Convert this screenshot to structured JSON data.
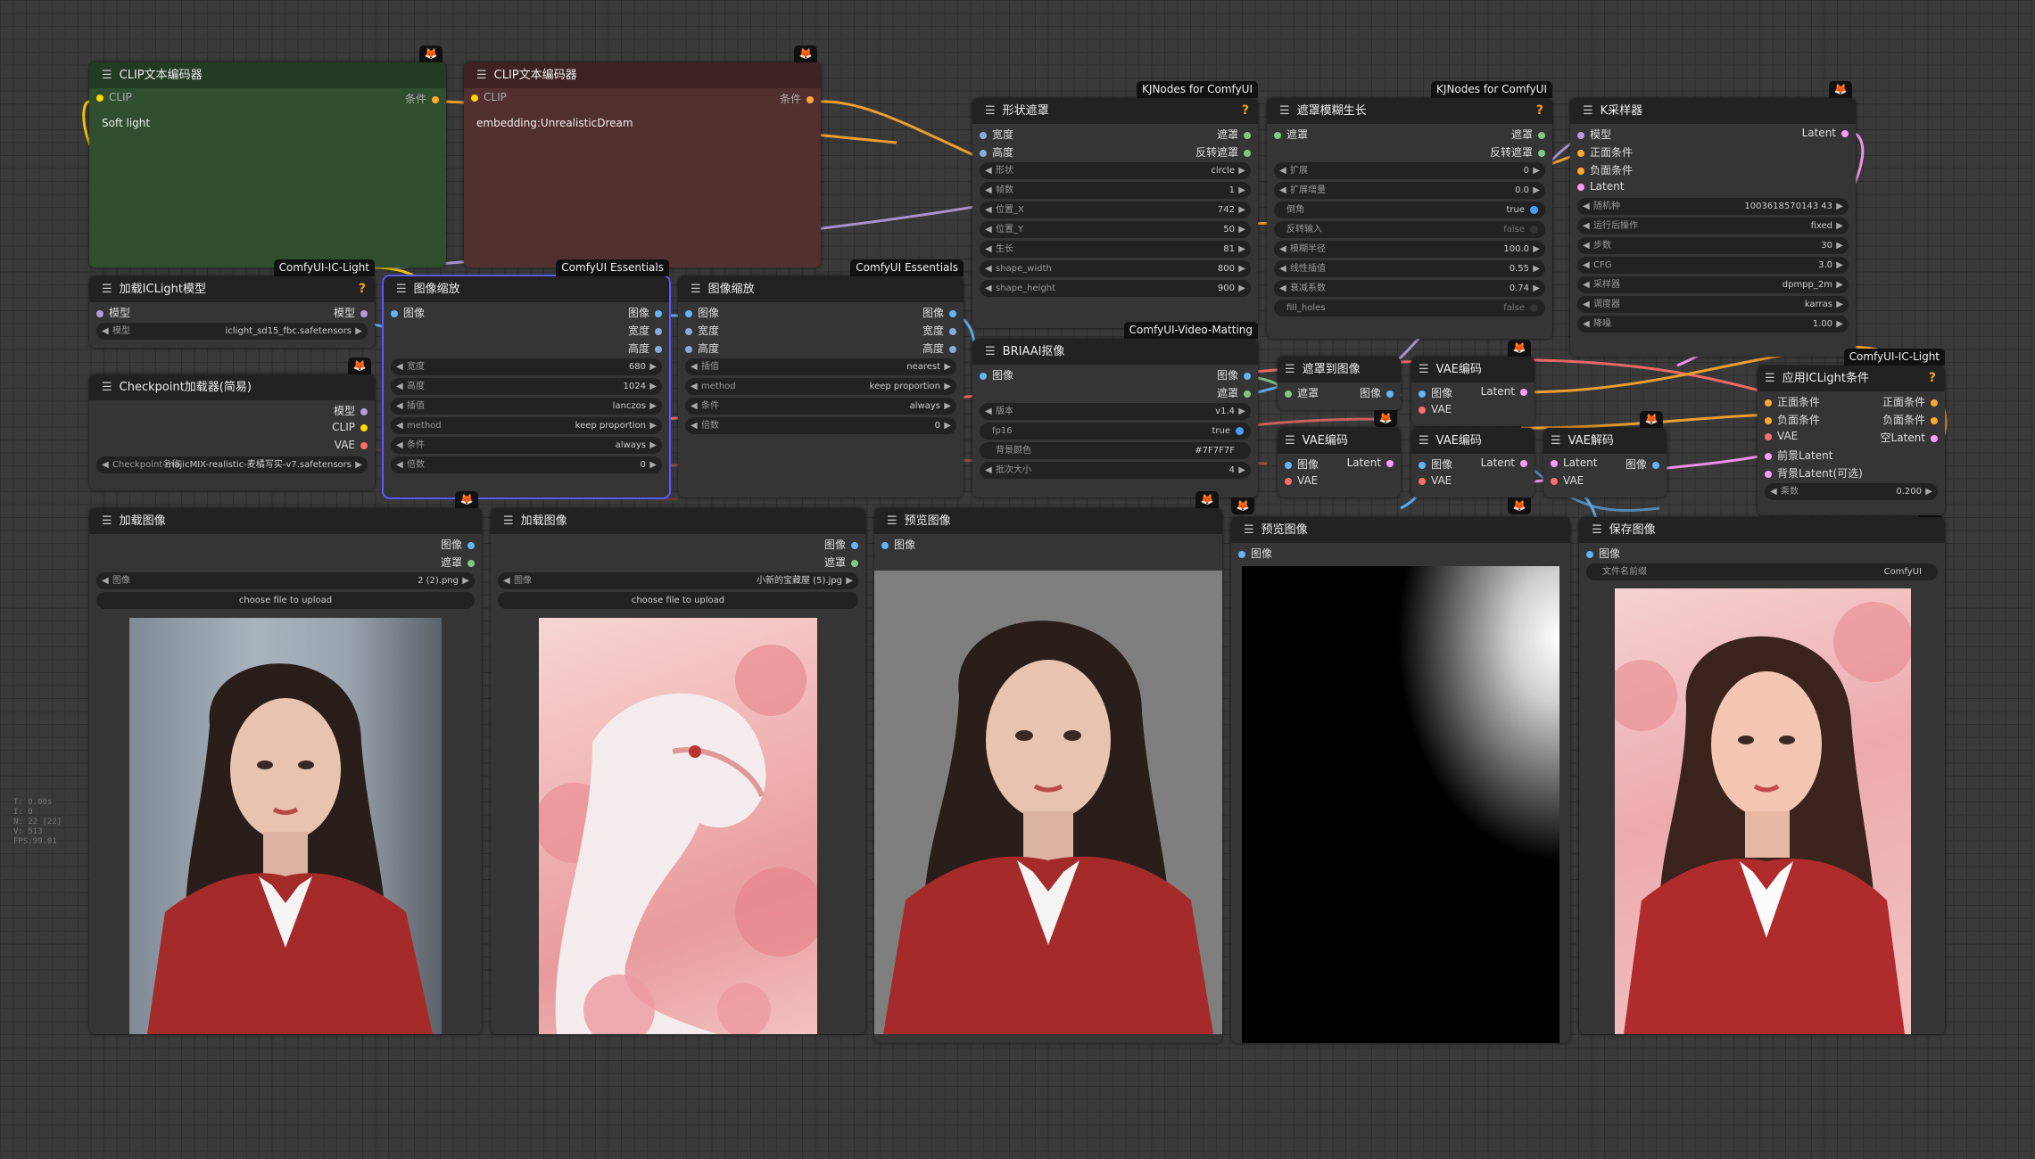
{
  "colors": {
    "clip_text_green_bg": "#2f4f2f",
    "clip_text_red_bg": "#533030",
    "image_wire": "#64b5f6",
    "mask_wire": "#81c784",
    "clip_wire": "#ffd500",
    "conditioning_wire": "#ffa931",
    "model_wire": "#b39ddb",
    "vae_wire": "#ff6e6e",
    "latent_wire": "#ff9cf9"
  },
  "nodes": {
    "clip_pos": {
      "title": "CLIP文本编码器",
      "in": "CLIP",
      "out": "条件",
      "text": "Soft light"
    },
    "clip_neg": {
      "title": "CLIP文本编码器",
      "in": "CLIP",
      "out": "条件",
      "text": "embedding:UnrealisticDream"
    },
    "iclight_loader": {
      "title": "加载ICLight模型",
      "badge": "ComfyUI-IC-Light",
      "in": "模型",
      "out": "模型",
      "w_name": "模型",
      "w_val": "iclight_sd15_fbc.safetensors"
    },
    "ckpt": {
      "title": "Checkpoint加载器(简易)",
      "out1": "模型",
      "out2": "CLIP",
      "out3": "VAE",
      "w_name": "Checkpoint名称",
      "w_val": "majicMIX-realistic-麦橘写实-v7.safetensors"
    },
    "scale1": {
      "title": "图像缩放",
      "badge": "ComfyUI Essentials",
      "in1": "图像",
      "out1": "图像",
      "out2": "宽度",
      "out3": "高度",
      "widgets": [
        [
          "宽度",
          "680"
        ],
        [
          "高度",
          "1024"
        ],
        [
          "插值",
          "lanczos"
        ],
        [
          "method",
          "keep proportion"
        ],
        [
          "条件",
          "always"
        ],
        [
          "倍数",
          "0"
        ]
      ]
    },
    "scale2": {
      "title": "图像缩放",
      "badge": "ComfyUI Essentials",
      "in1": "图像",
      "in2": "宽度",
      "in3": "高度",
      "out1": "图像",
      "out2": "宽度",
      "out3": "高度",
      "widgets": [
        [
          "插值",
          "nearest"
        ],
        [
          "method",
          "keep proportion"
        ],
        [
          "条件",
          "always"
        ],
        [
          "倍数",
          "0"
        ]
      ]
    },
    "shape_mask": {
      "title": "形状遮罩",
      "badge": "KJNodes for ComfyUI",
      "in1": "宽度",
      "in2": "高度",
      "out1": "遮罩",
      "out2": "反转遮罩",
      "widgets": [
        [
          "形状",
          "circle"
        ],
        [
          "帧数",
          "1"
        ],
        [
          "位置_X",
          "742"
        ],
        [
          "位置_Y",
          "50"
        ],
        [
          "生长",
          "81"
        ],
        [
          "shape_width",
          "800"
        ],
        [
          "shape_height",
          "900"
        ]
      ]
    },
    "grow_blur": {
      "title": "遮罩模糊生长",
      "badge": "KJNodes for ComfyUI",
      "in1": "遮罩",
      "out1": "遮罩",
      "out2": "反转遮罩",
      "widgets": [
        [
          "扩展",
          "0"
        ],
        [
          "扩展增量",
          "0.0"
        ],
        [
          "倒角",
          "true"
        ],
        [
          "反转输入",
          "false"
        ],
        [
          "模糊半径",
          "100.0"
        ],
        [
          "线性插值",
          "0.55"
        ],
        [
          "衰减系数",
          "0.74"
        ],
        [
          "fill_holes",
          "false"
        ]
      ]
    },
    "ksampler": {
      "title": "K采样器",
      "in1": "模型",
      "in2": "正面条件",
      "in3": "负面条件",
      "in4": "Latent",
      "out1": "Latent",
      "widgets": [
        [
          "随机种",
          "1003618570143 43"
        ],
        [
          "运行后操作",
          "fixed"
        ],
        [
          "步数",
          "30"
        ],
        [
          "CFG",
          "3.0"
        ],
        [
          "采样器",
          "dpmpp_2m"
        ],
        [
          "调度器",
          "karras"
        ],
        [
          "降噪",
          "1.00"
        ]
      ]
    },
    "briaai": {
      "title": "BRIAAI抠像",
      "badge": "ComfyUI-Video-Matting",
      "in1": "图像",
      "out1": "图像",
      "out2": "遮罩",
      "widgets": [
        [
          "版本",
          "v1.4"
        ],
        [
          "fp16",
          "true"
        ],
        [
          "背景颜色",
          "#7F7F7F"
        ],
        [
          "批次大小",
          "4"
        ]
      ]
    },
    "mask_to_img": {
      "title": "遮罩到图像",
      "in1": "遮罩",
      "out1": "图像"
    },
    "vae_enc1": {
      "title": "VAE编码",
      "in1": "图像",
      "in2": "VAE",
      "out1": "Latent"
    },
    "vae_enc2": {
      "title": "VAE编码",
      "in1": "图像",
      "in2": "VAE",
      "out1": "Latent"
    },
    "vae_enc3": {
      "title": "VAE编码",
      "in1": "图像",
      "in2": "VAE",
      "out1": "Latent"
    },
    "vae_dec": {
      "title": "VAE解码",
      "in1": "Latent",
      "in2": "VAE",
      "out1": "图像"
    },
    "apply_iclight": {
      "title": "应用ICLight条件",
      "badge": "ComfyUI-IC-Light",
      "in1": "正面条件",
      "in2": "负面条件",
      "in3": "VAE",
      "in4": "前景Latent",
      "in5": "背景Latent(可选)",
      "out1": "正面条件",
      "out2": "负面条件",
      "out3": "空Latent",
      "w_name": "乘数",
      "w_val": "0.200"
    },
    "load1": {
      "title": "加载图像",
      "out1": "图像",
      "out2": "遮罩",
      "w_name": "图像",
      "w_val": "2 (2).png",
      "btn": "choose file to upload"
    },
    "load2": {
      "title": "加载图像",
      "out1": "图像",
      "out2": "遮罩",
      "w_name": "图像",
      "w_val": "小新的宝藏屋 (5).jpg",
      "btn": "choose file to upload"
    },
    "preview1": {
      "title": "预览图像",
      "in1": "图像"
    },
    "preview2": {
      "title": "预览图像",
      "in1": "图像"
    },
    "save": {
      "title": "保存图像",
      "in1": "图像",
      "w_name": "文件名前缀",
      "w_val": "ComfyUI"
    }
  },
  "stats": [
    "T: 0.00s",
    "I: 0",
    "N: 22 [22]",
    "V: 513",
    "FPS:99.01"
  ]
}
